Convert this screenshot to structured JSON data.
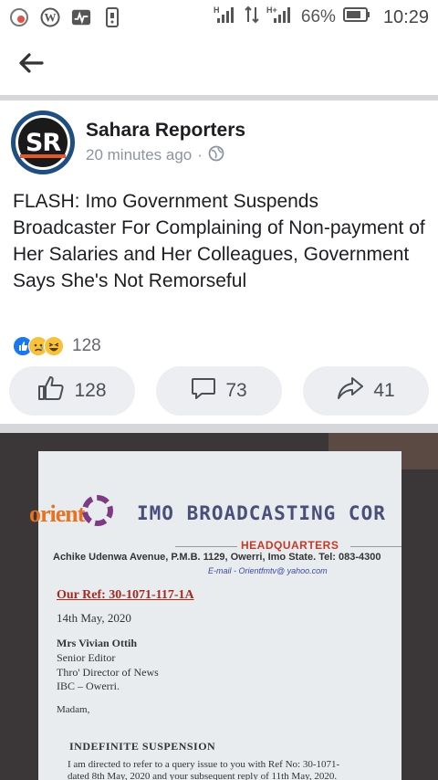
{
  "status_bar": {
    "battery": "66%",
    "time": "10:29",
    "network1": "H",
    "network2": "H+",
    "icons": [
      "notification-icon",
      "wordpress-icon",
      "activity-icon",
      "phone-icon"
    ]
  },
  "post": {
    "page_name": "Sahara Reporters",
    "avatar_initials": "SR",
    "time": "20 minutes ago",
    "separator": "·",
    "text": "FLASH: Imo Government Suspends Broadcaster For Complaining of Non-payment of Her Salaries and Her Colleagues, Government Says She's Not Remorseful",
    "reaction_count": "128",
    "actions": {
      "like_count": "128",
      "comment_count": "73",
      "share_count": "41"
    }
  },
  "photo_document": {
    "brand": "orient",
    "title": "IMO BROADCASTING COR",
    "headquarters": "HEADQUARTERS",
    "address": "Achike Udenwa Avenue, P.M.B. 1129, Owerri, Imo State. Tel: 083-4300",
    "email": "E-mail - Orientfmtv@ yahoo.com",
    "ref": "Our Ref: 30-1071-117-1A",
    "date": "14th May, 2020",
    "recipient_name": "Mrs Vivian Ottih",
    "recipient_line1": "Senior Editor",
    "recipient_line2": "Thro' Director of News",
    "recipient_line3": "IBC – Owerri.",
    "salutation": "Madam,",
    "heading": "INDEFINITE SUSPENSION",
    "body_line1": "I am directed to refer to a query issue to you with Ref No: 30-1071-",
    "body_line2": "dated 8th May, 2020 and your subsequent reply of 11th May, 2020."
  },
  "colors": {
    "like_blue": "#1877f2",
    "button_bg": "#eceef1",
    "divider": "#d5d7db"
  }
}
